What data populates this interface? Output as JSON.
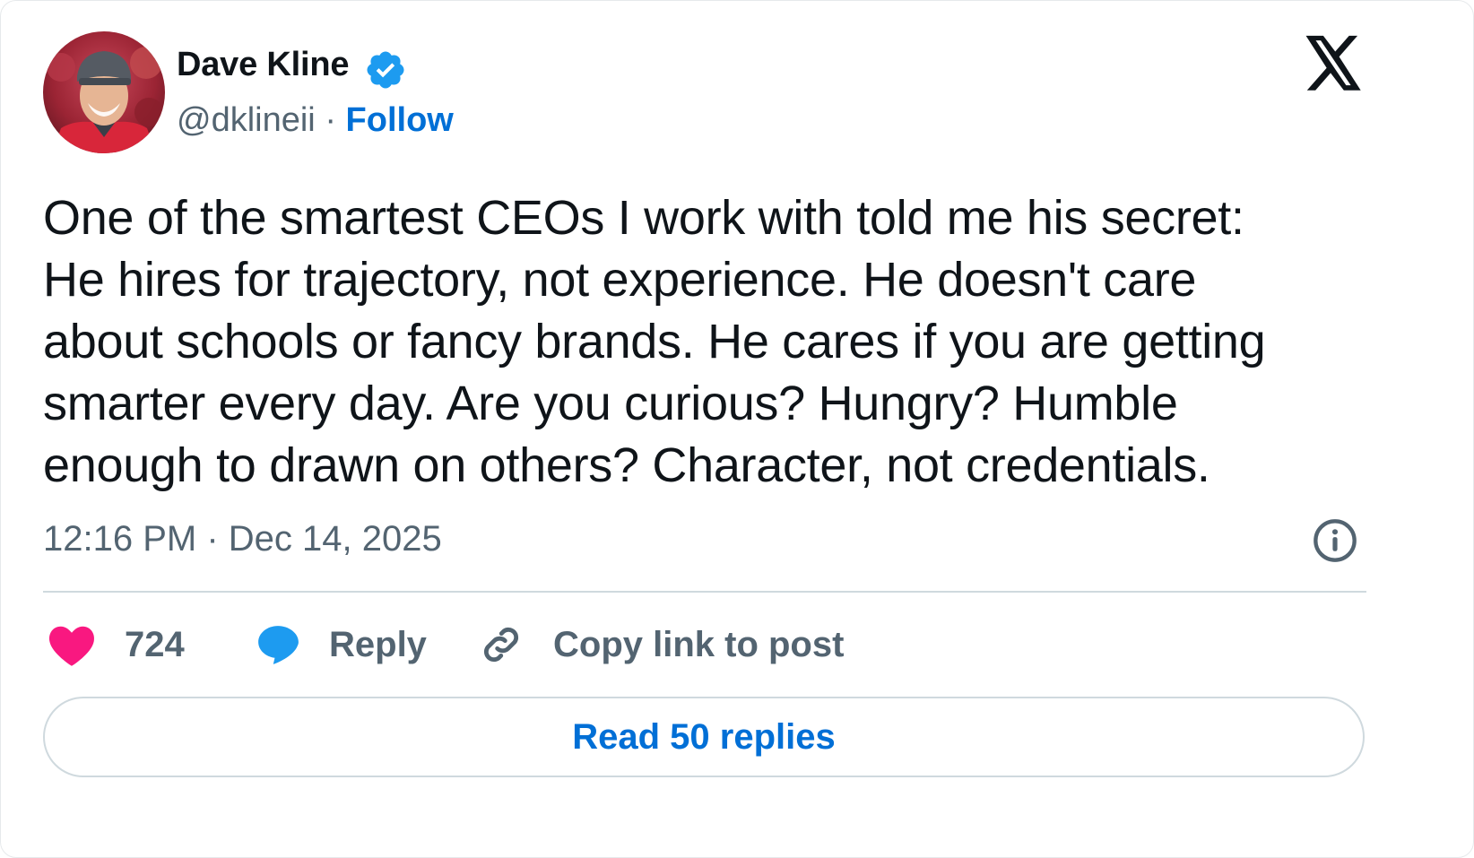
{
  "author": {
    "name": "Dave Kline",
    "handle": "@dklineii",
    "separator": "·",
    "follow_label": "Follow",
    "verified": true
  },
  "tweet": {
    "lines": [
      "One of the smartest CEOs I work with told me his secret:",
      "He hires for trajectory, not experience. He doesn't care",
      "about schools or fancy brands. He cares if you are getting",
      "smarter every day. Are you curious? Hungry? Humble",
      "enough to drawn on others? Character, not credentials."
    ],
    "timestamp": "12:16 PM · Dec 14, 2025"
  },
  "actions": {
    "like_count": "724",
    "reply_label": "Reply",
    "copy_label": "Copy link to post"
  },
  "read_replies_label": "Read 50 replies",
  "icons": {
    "brand": "x-logo-icon",
    "verified": "verified-badge-icon",
    "info": "info-icon",
    "like": "heart-icon",
    "reply": "speech-bubble-icon",
    "copy": "link-icon"
  },
  "colors": {
    "accent": "#006fd6",
    "like": "#f91880",
    "reply": "#1d9bf0",
    "muted": "#536471",
    "text": "#0f1419",
    "border": "#cfd9de"
  }
}
